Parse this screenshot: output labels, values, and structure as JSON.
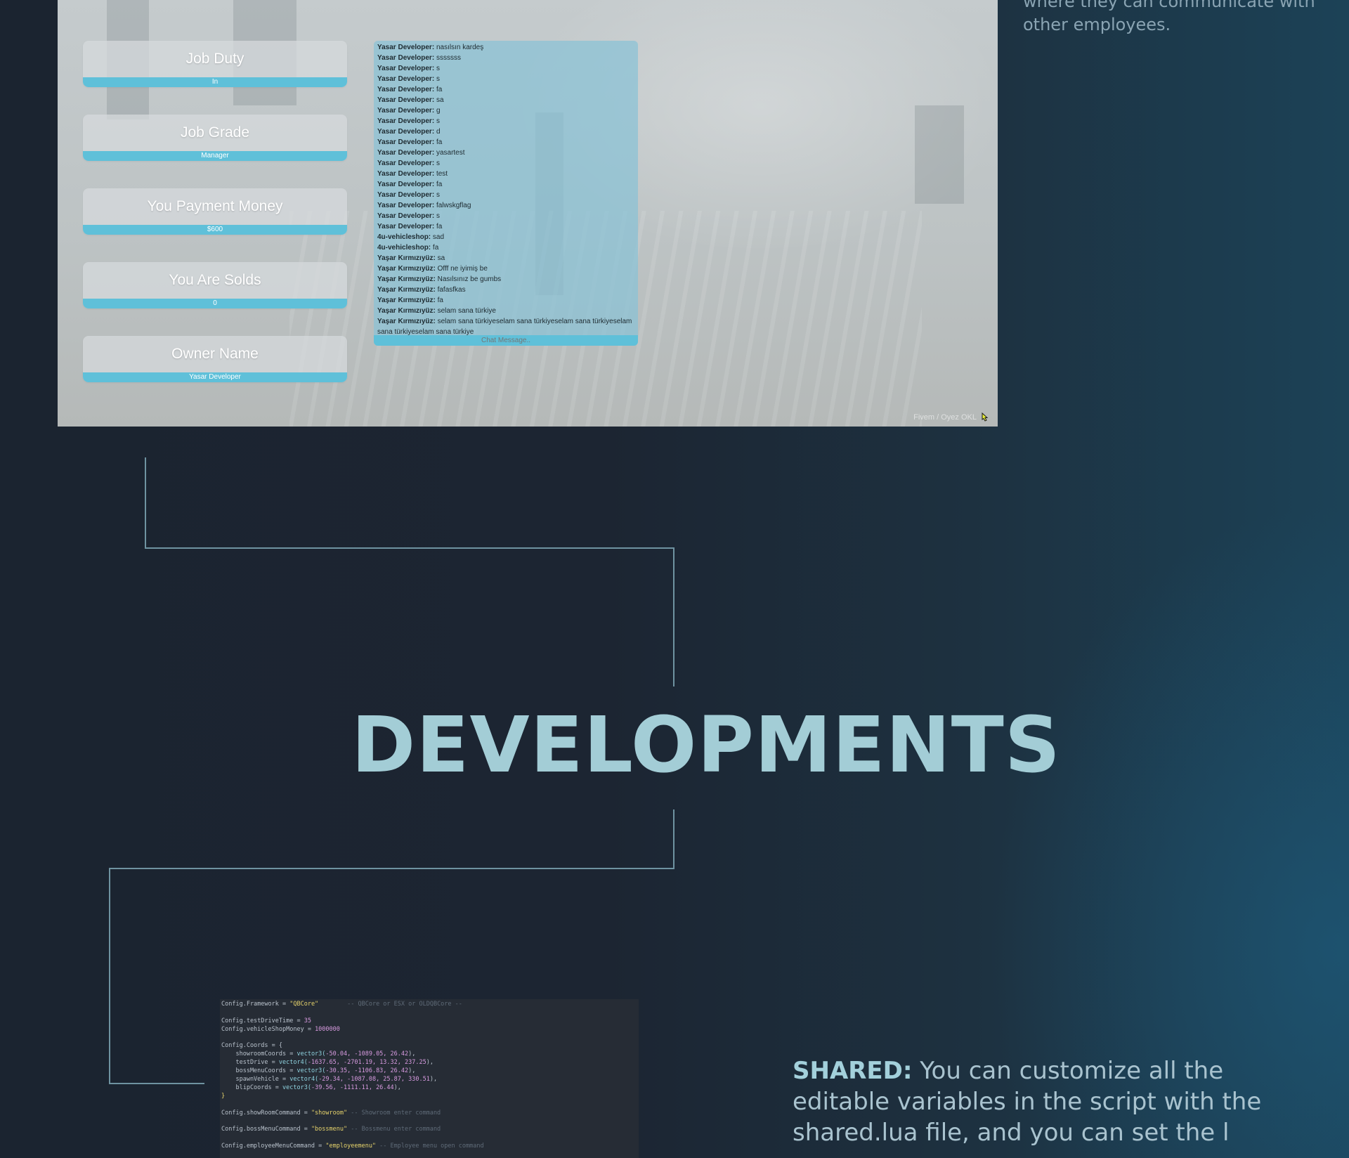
{
  "intro": {
    "text": "where they can communicate with other employees."
  },
  "boss_menu": {
    "stats": [
      {
        "label": "Job Duty",
        "value": "In"
      },
      {
        "label": "Job Grade",
        "value": "Manager"
      },
      {
        "label": "You Payment Money",
        "value": "$600"
      },
      {
        "label": "You Are Solds",
        "value": "0"
      },
      {
        "label": "Owner Name",
        "value": "Yasar Developer"
      }
    ],
    "chat": {
      "messages": [
        {
          "author": "Yasar Developer:",
          "text": " nasılsın kardeş"
        },
        {
          "author": "Yasar Developer:",
          "text": " sssssss"
        },
        {
          "author": "Yasar Developer:",
          "text": " s"
        },
        {
          "author": "Yasar Developer:",
          "text": " s"
        },
        {
          "author": "Yasar Developer:",
          "text": " fa"
        },
        {
          "author": "Yasar Developer:",
          "text": " sa"
        },
        {
          "author": "Yasar Developer:",
          "text": " g"
        },
        {
          "author": "Yasar Developer:",
          "text": " s"
        },
        {
          "author": "Yasar Developer:",
          "text": " d"
        },
        {
          "author": "Yasar Developer:",
          "text": " fa"
        },
        {
          "author": "Yasar Developer:",
          "text": " yasartest"
        },
        {
          "author": "Yasar Developer:",
          "text": " s"
        },
        {
          "author": "Yasar Developer:",
          "text": " test"
        },
        {
          "author": "Yasar Developer:",
          "text": " fa"
        },
        {
          "author": "Yasar Developer:",
          "text": " s"
        },
        {
          "author": "Yasar Developer:",
          "text": " falwskgflag"
        },
        {
          "author": "Yasar Developer:",
          "text": " s"
        },
        {
          "author": "Yasar Developer:",
          "text": " fa"
        },
        {
          "author": "4u-vehicleshop:",
          "text": " sad"
        },
        {
          "author": "4u-vehicleshop:",
          "text": " fa"
        },
        {
          "author": "Yaşar Kırmızıyüz:",
          "text": " sa"
        },
        {
          "author": "Yaşar Kırmızıyüz:",
          "text": " Offf ne iyimiş be"
        },
        {
          "author": "Yaşar Kırmızıyüz:",
          "text": " Nasılsınız be gumbs"
        },
        {
          "author": "Yaşar Kırmızıyüz:",
          "text": " fafasfkas"
        },
        {
          "author": "Yaşar Kırmızıyüz:",
          "text": " fa"
        },
        {
          "author": "Yaşar Kırmızıyüz:",
          "text": " selam sana türkiye"
        },
        {
          "author": "Yaşar Kırmızıyüz:",
          "text": " selam sana türkiyeselam sana türkiyeselam sana türkiyeselam sana türkiyeselam sana türkiye"
        }
      ],
      "input_placeholder": "Chat Message.."
    },
    "watermark": "Fivem / Oyez OKL",
    "cursor_icon": "pointer-hand-icon"
  },
  "developments": {
    "title": "DEVELOPMENTS"
  },
  "code": {
    "colors": {
      "key": "#b9c2cc",
      "string": "#e6d36b",
      "number": "#d89be0",
      "comment": "#5f6b78",
      "func": "#8fd3e0"
    },
    "lines": [
      [
        {
          "t": "Config.Framework = ",
          "c": "key"
        },
        {
          "t": "\"QBCore\"",
          "c": "string"
        },
        {
          "t": "        -- QBCore or ESX or OLDQBCore --",
          "c": "comment"
        }
      ],
      [],
      [
        {
          "t": "Config.testDriveTime = ",
          "c": "key"
        },
        {
          "t": "35",
          "c": "number"
        }
      ],
      [
        {
          "t": "Config.vehicleShopMoney = ",
          "c": "key"
        },
        {
          "t": "1000000",
          "c": "number"
        }
      ],
      [],
      [
        {
          "t": "Config.Coords = {",
          "c": "key"
        }
      ],
      [
        {
          "t": "    showroomCoords = ",
          "c": "key"
        },
        {
          "t": "vector3(",
          "c": "func"
        },
        {
          "t": "-50.04, -1089.05, 26.42",
          "c": "number"
        },
        {
          "t": "),",
          "c": "key"
        }
      ],
      [
        {
          "t": "    testDrive = ",
          "c": "key"
        },
        {
          "t": "vector4(",
          "c": "func"
        },
        {
          "t": "-1637.65, -2701.19, 13.32, 237.25",
          "c": "number"
        },
        {
          "t": "),",
          "c": "key"
        }
      ],
      [
        {
          "t": "    bossMenuCoords = ",
          "c": "key"
        },
        {
          "t": "vector3(",
          "c": "func"
        },
        {
          "t": "-30.35, -1106.83, 26.42",
          "c": "number"
        },
        {
          "t": "),",
          "c": "key"
        }
      ],
      [
        {
          "t": "    spawnVehicle = ",
          "c": "key"
        },
        {
          "t": "vector4(",
          "c": "func"
        },
        {
          "t": "-29.34, -1087.08, 25.87, 330.51",
          "c": "number"
        },
        {
          "t": "),",
          "c": "key"
        }
      ],
      [
        {
          "t": "    blipCoords = ",
          "c": "key"
        },
        {
          "t": "vector3(",
          "c": "func"
        },
        {
          "t": "-39.56, -1111.11, 26.44",
          "c": "number"
        },
        {
          "t": "),",
          "c": "key"
        }
      ],
      [
        {
          "t": "}",
          "c": "string"
        }
      ],
      [],
      [
        {
          "t": "Config.showRoomCommand = ",
          "c": "key"
        },
        {
          "t": "\"showroom\"",
          "c": "string"
        },
        {
          "t": " -- Showroom enter command",
          "c": "comment"
        }
      ],
      [],
      [
        {
          "t": "Config.bossMenuCommand = ",
          "c": "key"
        },
        {
          "t": "\"bossmenu\"",
          "c": "string"
        },
        {
          "t": " -- Bossmenu enter command",
          "c": "comment"
        }
      ],
      [],
      [
        {
          "t": "Config.employeeMenuCommand = ",
          "c": "key"
        },
        {
          "t": "\"employeemenu\"",
          "c": "string"
        },
        {
          "t": " -- Employee menu open command",
          "c": "comment"
        }
      ]
    ]
  },
  "shared": {
    "label": "SHARED:",
    "text": " You can customize all the editable variables in the script with the shared.lua file, and you can set the l"
  }
}
